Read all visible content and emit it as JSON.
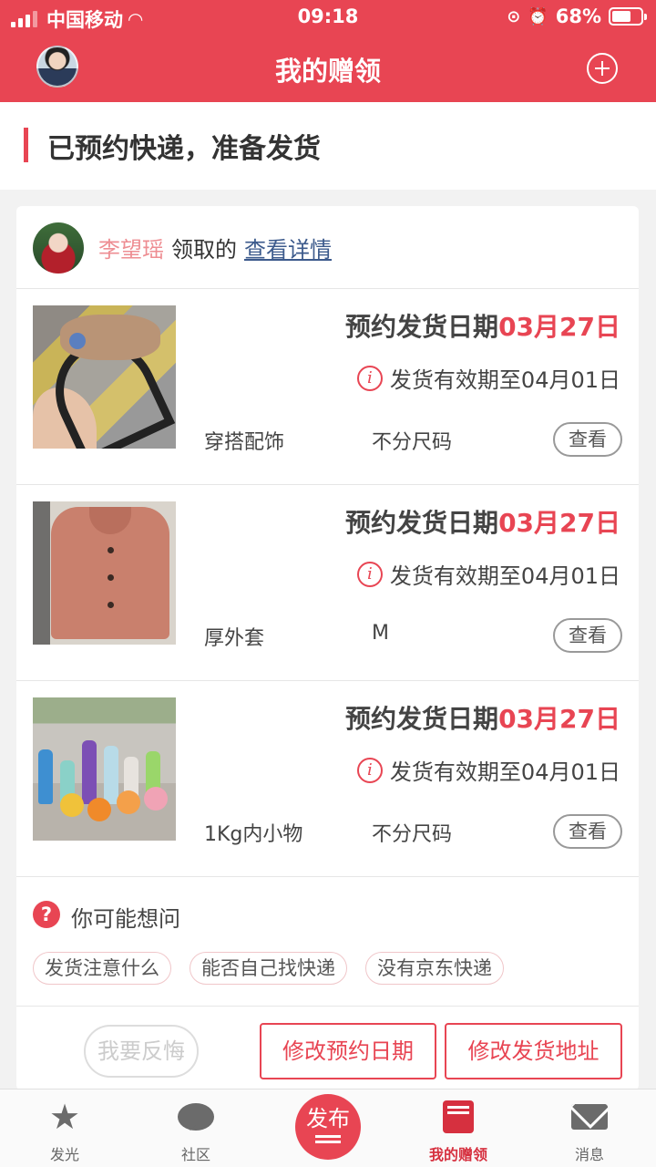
{
  "status_bar": {
    "carrier": "中国移动",
    "time": "09:18",
    "battery": "68%",
    "battery_level": 0.68
  },
  "header": {
    "title": "我的赠领"
  },
  "section": {
    "title": "已预约快递，准备发货"
  },
  "claimer": {
    "name": "李望瑶",
    "action": "领取的",
    "link": "查看详情"
  },
  "items": [
    {
      "date_label": "预约发货日期",
      "date_value": "03月27日",
      "valid_text": "发货有效期至04月01日",
      "category": "穿搭配饰",
      "size": "不分尺码",
      "view_label": "查看",
      "info_glyph": "i"
    },
    {
      "date_label": "预约发货日期",
      "date_value": "03月27日",
      "valid_text": "发货有效期至04月01日",
      "category": "厚外套",
      "size": "M",
      "view_label": "查看",
      "info_glyph": "i"
    },
    {
      "date_label": "预约发货日期",
      "date_value": "03月27日",
      "valid_text": "发货有效期至04月01日",
      "category": "1Kg内小物",
      "size": "不分尺码",
      "view_label": "查看",
      "info_glyph": "i"
    }
  ],
  "faq": {
    "icon_glyph": "?",
    "title": "你可能想问",
    "chips": [
      "发货注意什么",
      "能否自己找快递",
      "没有京东快递"
    ]
  },
  "actions": {
    "regret": "我要反悔",
    "modify_date": "修改预约日期",
    "modify_address": "修改发货地址"
  },
  "tabbar": {
    "items": [
      {
        "label": "发光",
        "icon": "star-icon"
      },
      {
        "label": "社区",
        "icon": "chat-icon"
      },
      {
        "label": "发布",
        "icon": "publish-icon"
      },
      {
        "label": "我的赠领",
        "icon": "gift-book-icon",
        "active": true
      },
      {
        "label": "消息",
        "icon": "mail-icon"
      }
    ]
  },
  "colors": {
    "brand": "#e84553",
    "link": "#3c5a8c",
    "claimer_name": "#ee8e93"
  }
}
